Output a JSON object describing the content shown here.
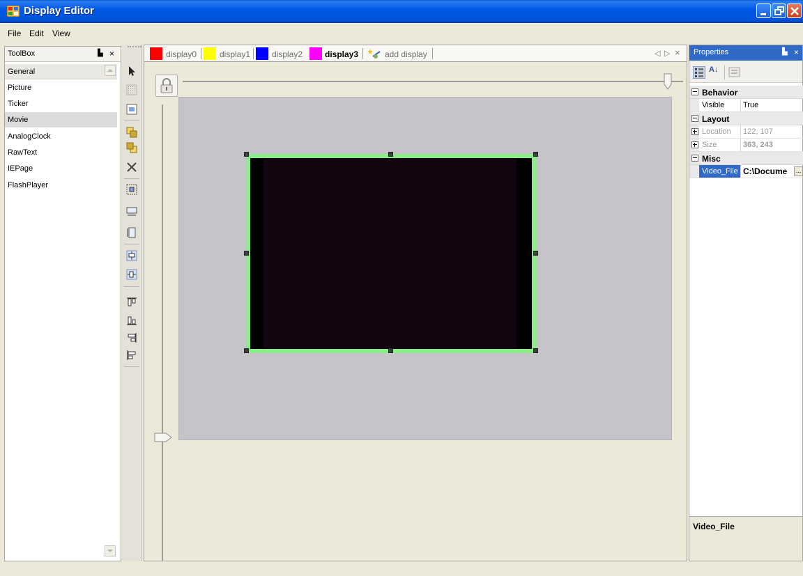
{
  "window": {
    "title": "Display Editor"
  },
  "menu": [
    "File",
    "Edit",
    "View"
  ],
  "toolbox": {
    "title": "ToolBox",
    "pin_glyph": "▙",
    "close_glyph": "×",
    "group": "General",
    "items": [
      "Picture",
      "Ticker",
      "Movie",
      "AnalogClock",
      "RawText",
      "IEPage",
      "FlashPlayer"
    ],
    "selected": "Movie"
  },
  "tabs": {
    "items": [
      {
        "label": "display0",
        "color": "#ff0000",
        "active": false
      },
      {
        "label": "display1",
        "color": "#ffff00",
        "active": false
      },
      {
        "label": "display2",
        "color": "#0000ff",
        "active": false
      },
      {
        "label": "display3",
        "color": "#ff00ff",
        "active": true
      }
    ],
    "add_label": "add display",
    "nav_left": "◁",
    "nav_right": "▷",
    "close": "×"
  },
  "canvas": {
    "background": "#c6c3c9",
    "element_border": "#88ee88"
  },
  "properties": {
    "title": "Properties",
    "pin_glyph": "▙",
    "close_glyph": "×",
    "sort_az_glyph": "A↓",
    "categories": {
      "behavior": "Behavior",
      "layout": "Layout",
      "misc": "Misc"
    },
    "rows": {
      "visible": {
        "name": "Visible",
        "value": "True"
      },
      "location": {
        "name": "Location",
        "value": "122, 107"
      },
      "size": {
        "name": "Size",
        "value": "363, 243"
      },
      "video_file": {
        "name": "Video_File",
        "value": "C:\\Docume",
        "button": "..."
      }
    },
    "description_title": "Video_File"
  }
}
